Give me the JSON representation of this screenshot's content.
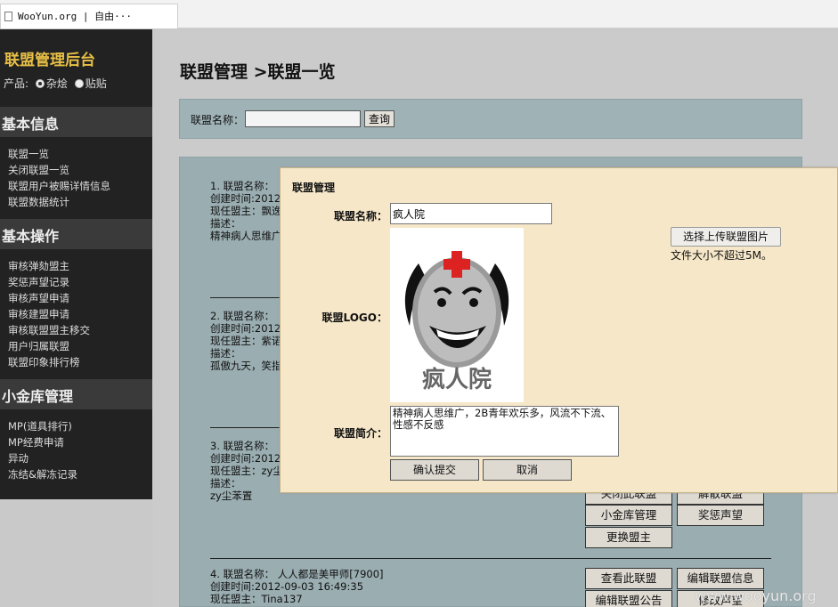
{
  "browser": {
    "tab_title": "WooYun.org | 自由···"
  },
  "sidebar": {
    "brand": "联盟管理后台",
    "product_label": "产品:",
    "products": [
      "杂烩",
      "贴贴"
    ],
    "sections": [
      {
        "title": "基本信息",
        "items": [
          "联盟一览",
          "关闭联盟一览",
          "联盟用户被赐详情信息",
          "联盟数据统计"
        ]
      },
      {
        "title": "基本操作",
        "items": [
          "审核弹劾盟主",
          "奖惩声望记录",
          "审核声望申请",
          "审核建盟申请",
          "审核联盟盟主移交",
          "用户归属联盟",
          "联盟印象排行榜"
        ]
      },
      {
        "title": "小金库管理",
        "items": [
          "MP(道具排行)",
          "MP经费申请",
          "异动",
          "冻结&解冻记录"
        ]
      }
    ]
  },
  "main": {
    "title": "联盟管理 >联盟一览",
    "search": {
      "label": "联盟名称：",
      "button": "查询",
      "value": ""
    },
    "items": [
      {
        "l1": "1. 联盟名称：",
        "l2": "创建时间:2012",
        "l3": "现任盟主：飘逸",
        "l4": "描述：",
        "l5": "精神病人思维广"
      },
      {
        "l1": "2. 联盟名称：",
        "l2": "创建时间:2012",
        "l3": "现任盟主：紫诺",
        "l4": "描述：",
        "l5": "孤傲九天，笑指"
      },
      {
        "l1": "3. 联盟名称：",
        "l2": "创建时间:2012",
        "l3": "现任盟主：zy尘",
        "l4": "描述：",
        "l5": "zy尘苯置"
      },
      {
        "l1": "4. 联盟名称： 人人都是美甲师[7900]",
        "l2": "创建时间:2012-09-03 16:49:35",
        "l3": "现任盟主：Tina137",
        "l4": "",
        "l5": ""
      }
    ],
    "actions3": [
      "关闭此联盟",
      "解散联盟",
      "小金库管理",
      "奖惩声望",
      "更换盟主"
    ],
    "actions4": [
      "查看此联盟",
      "编辑联盟信息",
      "编辑联盟公告",
      "修改声望"
    ]
  },
  "modal": {
    "title": "联盟管理",
    "name_label": "联盟名称：",
    "name_value": "疯人院",
    "logo_label": "联盟LOGO：",
    "logo_text": "疯人院",
    "upload_button": "选择上传联盟图片",
    "upload_hint": "文件大小不超过5M。",
    "intro_label": "联盟简介：",
    "intro_value": "精神病人思维广，2B青年欢乐多，风流不下流、性感不反感",
    "confirm_button": "确认提交",
    "cancel_button": "取消"
  },
  "watermark": "www.wooyun.org"
}
